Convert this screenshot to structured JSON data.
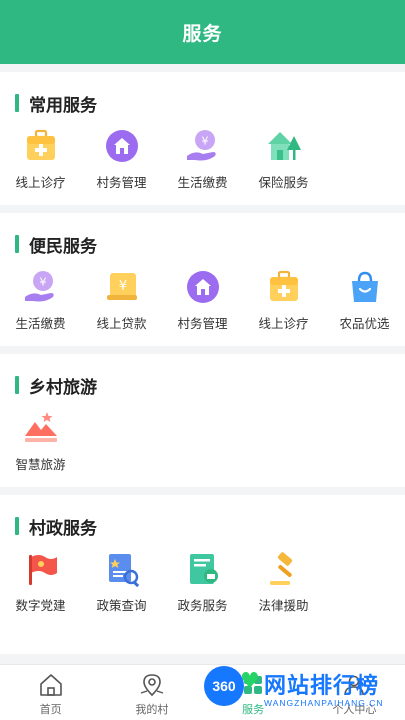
{
  "header": {
    "title": "服务"
  },
  "sections": [
    {
      "title": "常用服务",
      "items": [
        {
          "label": "线上诊疗",
          "icon": "medical-kit-icon"
        },
        {
          "label": "村务管理",
          "icon": "village-house-icon"
        },
        {
          "label": "生活缴费",
          "icon": "yuan-hand-icon"
        },
        {
          "label": "保险服务",
          "icon": "house-tree-icon"
        }
      ]
    },
    {
      "title": "便民服务",
      "items": [
        {
          "label": "生活缴费",
          "icon": "yuan-hand-icon"
        },
        {
          "label": "线上贷款",
          "icon": "yuan-card-icon"
        },
        {
          "label": "村务管理",
          "icon": "village-house-icon"
        },
        {
          "label": "线上诊疗",
          "icon": "medical-kit-icon"
        },
        {
          "label": "农品优选",
          "icon": "shopping-bag-icon"
        }
      ]
    },
    {
      "title": "乡村旅游",
      "items": [
        {
          "label": "智慧旅游",
          "icon": "mountain-icon"
        }
      ]
    },
    {
      "title": "村政服务",
      "items": [
        {
          "label": "数字党建",
          "icon": "red-flag-icon"
        },
        {
          "label": "政策查询",
          "icon": "document-search-icon"
        },
        {
          "label": "政务服务",
          "icon": "government-doc-icon"
        },
        {
          "label": "法律援助",
          "icon": "gavel-icon"
        }
      ]
    }
  ],
  "tabbar": [
    {
      "label": "首页",
      "icon": "home-icon"
    },
    {
      "label": "我的村",
      "icon": "location-pin-icon"
    },
    {
      "label": "服务",
      "icon": "service-icon",
      "active": true
    },
    {
      "label": "个人中心",
      "icon": "user-icon"
    }
  ],
  "watermark": {
    "badge": "360",
    "text": "网站排行榜",
    "sub": "WANGZHANPAIHANG.CN"
  },
  "colors": {
    "accent": "#2fb882"
  }
}
